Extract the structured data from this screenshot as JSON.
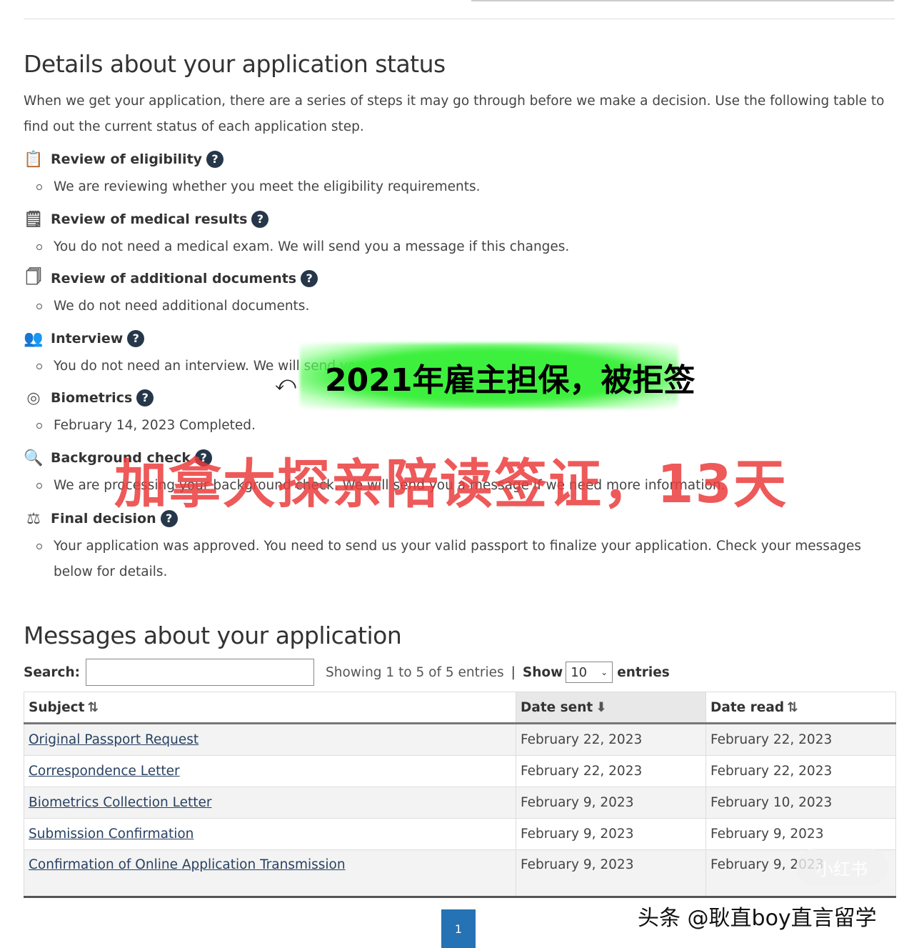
{
  "status": {
    "title": "Details about your application status",
    "intro": "When we get your application, there are a series of steps it may go through before we make a decision. Use the following table to find out the current status of each application step.",
    "steps": [
      {
        "icon": "eligibility-clipboard-icon",
        "title": "Review of eligibility",
        "desc": "We are reviewing whether you meet the eligibility requirements."
      },
      {
        "icon": "medical-clipboard-icon",
        "title": "Review of medical results",
        "desc": "You do not need a medical exam. We will send you a message if this changes."
      },
      {
        "icon": "documents-icon",
        "title": "Review of additional documents",
        "desc": "We do not need additional documents."
      },
      {
        "icon": "interview-people-icon",
        "title": "Interview",
        "desc": "You do not need an interview. We will send you a message if this changes."
      },
      {
        "icon": "fingerprint-icon",
        "title": "Biometrics",
        "desc": "February 14, 2023 Completed."
      },
      {
        "icon": "magnifier-person-icon",
        "title": "Background check",
        "desc": "We are processing your background check. We will send you a message if we need more information."
      },
      {
        "icon": "scales-icon",
        "title": "Final decision",
        "desc": "Your application was approved. You need to send us your valid passport to finalize your application. Check your messages below for details."
      }
    ]
  },
  "messages": {
    "title": "Messages about your application",
    "search_label": "Search:",
    "search_value": "",
    "info": "Showing 1 to 5 of 5 entries",
    "separator": "|",
    "show_label": "Show",
    "page_size": "10",
    "entries_label": "entries",
    "columns": [
      "Subject",
      "Date sent",
      "Date read"
    ],
    "sorted_column": "Date sent",
    "rows": [
      [
        "Original Passport Request",
        "February 22, 2023",
        "February 22, 2023"
      ],
      [
        "Correspondence Letter",
        "February 22, 2023",
        "February 22, 2023"
      ],
      [
        "Biometrics Collection Letter",
        "February 9, 2023",
        "February 10, 2023"
      ],
      [
        "Submission Confirmation",
        "February 9, 2023",
        "February 9, 2023"
      ],
      [
        "Confirmation of Online Application Transmission",
        "February 9, 2023",
        "February 9, 2023"
      ]
    ],
    "pagination": {
      "current_page": "1"
    }
  },
  "overlay": {
    "caption_green": "2021年雇主担保，被拒签",
    "caption_red": "加拿大探亲陪读签证，13天",
    "watermark": "头条 @耿直boy直言留学",
    "watermark_logo": "小红书"
  },
  "colors": {
    "help_icon": "#26374a",
    "link": "#284162",
    "page_button": "#2572b4",
    "green_highlight": "#3ef03e",
    "red_caption": "#eb3c3c"
  }
}
